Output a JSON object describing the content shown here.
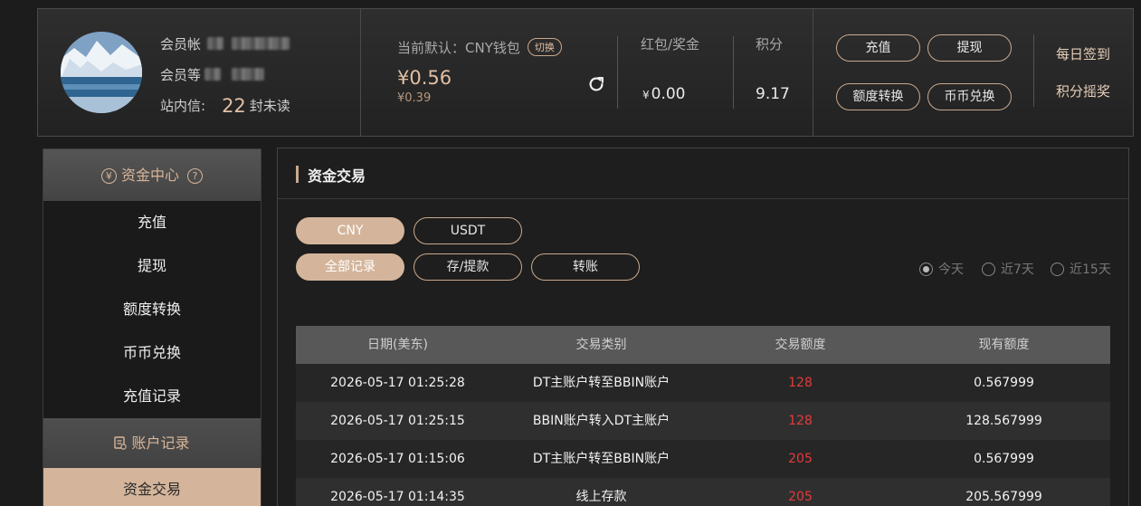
{
  "user": {
    "account_label": "会员帐",
    "level_label": "会员等",
    "message_label": "站内信:",
    "unread_count": "22",
    "unread_suffix": "封未读"
  },
  "wallet": {
    "default_label": "当前默认：CNY钱包",
    "switch_label": "切换",
    "balance": "¥0.56",
    "sub_balance": "¥0.39",
    "bonus_label": "红包/奖金",
    "bonus_currency": "¥",
    "bonus_value": "0.00",
    "points_label": "积分",
    "points_value": "9.17"
  },
  "actions": {
    "deposit": "充值",
    "withdraw": "提现",
    "transfer": "额度转换",
    "exchange": "币币兑换",
    "daily_signin": "每日签到",
    "points_lottery": "积分摇奖"
  },
  "sidebar": {
    "fund_center": "资金中心",
    "fund_help": "?",
    "items": [
      "充值",
      "提现",
      "额度转换",
      "币币兑换",
      "充值记录"
    ],
    "account_records": "账户记录",
    "active_item": "资金交易"
  },
  "main": {
    "title": "资金交易",
    "currency_tabs": [
      "CNY",
      "USDT"
    ],
    "record_tabs": [
      "全部记录",
      "存/提款",
      "转账"
    ],
    "date_filters": [
      "今天",
      "近7天",
      "近15天"
    ],
    "selected_date_filter": "今天",
    "table": {
      "headers": [
        "日期(美东)",
        "交易类别",
        "交易额度",
        "现有额度"
      ],
      "rows": [
        [
          "2026-05-17 01:25:28",
          "DT主账户转至BBIN账户",
          "128",
          "0.567999"
        ],
        [
          "2026-05-17 01:25:15",
          "BBIN账户转入DT主账户",
          "128",
          "128.567999"
        ],
        [
          "2026-05-17 01:15:06",
          "DT主账户转至BBIN账户",
          "205",
          "0.567999"
        ],
        [
          "2026-05-17 01:14:35",
          "线上存款",
          "205",
          "205.567999"
        ]
      ]
    }
  },
  "colors": {
    "accent": "#d4b59b",
    "amount_red": "#e53a3a",
    "background": "#1c1c1c"
  }
}
